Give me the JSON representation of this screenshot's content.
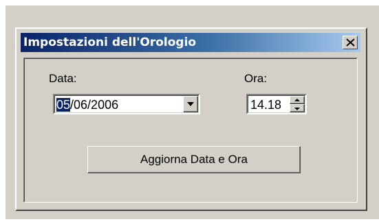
{
  "window": {
    "title": "Impostazioni dell'Orologio",
    "close_glyph": "close-icon"
  },
  "date": {
    "label": "Data:",
    "value_selected": "05",
    "value_rest": "/06/2006",
    "dropdown_icon": "chevron-down-icon"
  },
  "time": {
    "label": "Ora:",
    "value": "14.18",
    "up_icon": "spin-up-icon",
    "down_icon": "spin-down-icon"
  },
  "actions": {
    "update_label": "Aggiorna Data e Ora"
  },
  "colors": {
    "face": "#d4d0c8",
    "title_start": "#0a246a",
    "title_end": "#a6caf0",
    "selection": "#0a246a"
  }
}
